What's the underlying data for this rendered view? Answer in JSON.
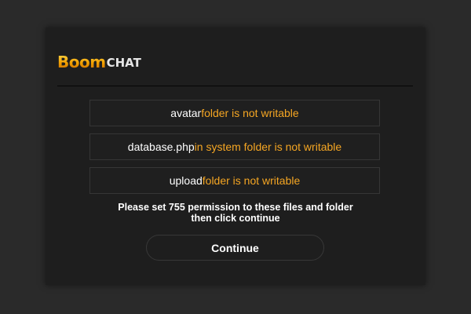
{
  "logo": {
    "part1": "Boom",
    "part2": "CHAT"
  },
  "errors": [
    {
      "name": "avatar",
      "message": " folder is not writable"
    },
    {
      "name": "database.php",
      "message": " in system folder is not writable"
    },
    {
      "name": "upload",
      "message": " folder is not writable"
    }
  ],
  "notice": {
    "line1": "Please set 755 permission to these files and folder",
    "line2": "then click continue"
  },
  "continue_label": "Continue",
  "colors": {
    "accent": "#f5a623",
    "background": "#2a2a2a",
    "panel": "#1e1e1e"
  }
}
